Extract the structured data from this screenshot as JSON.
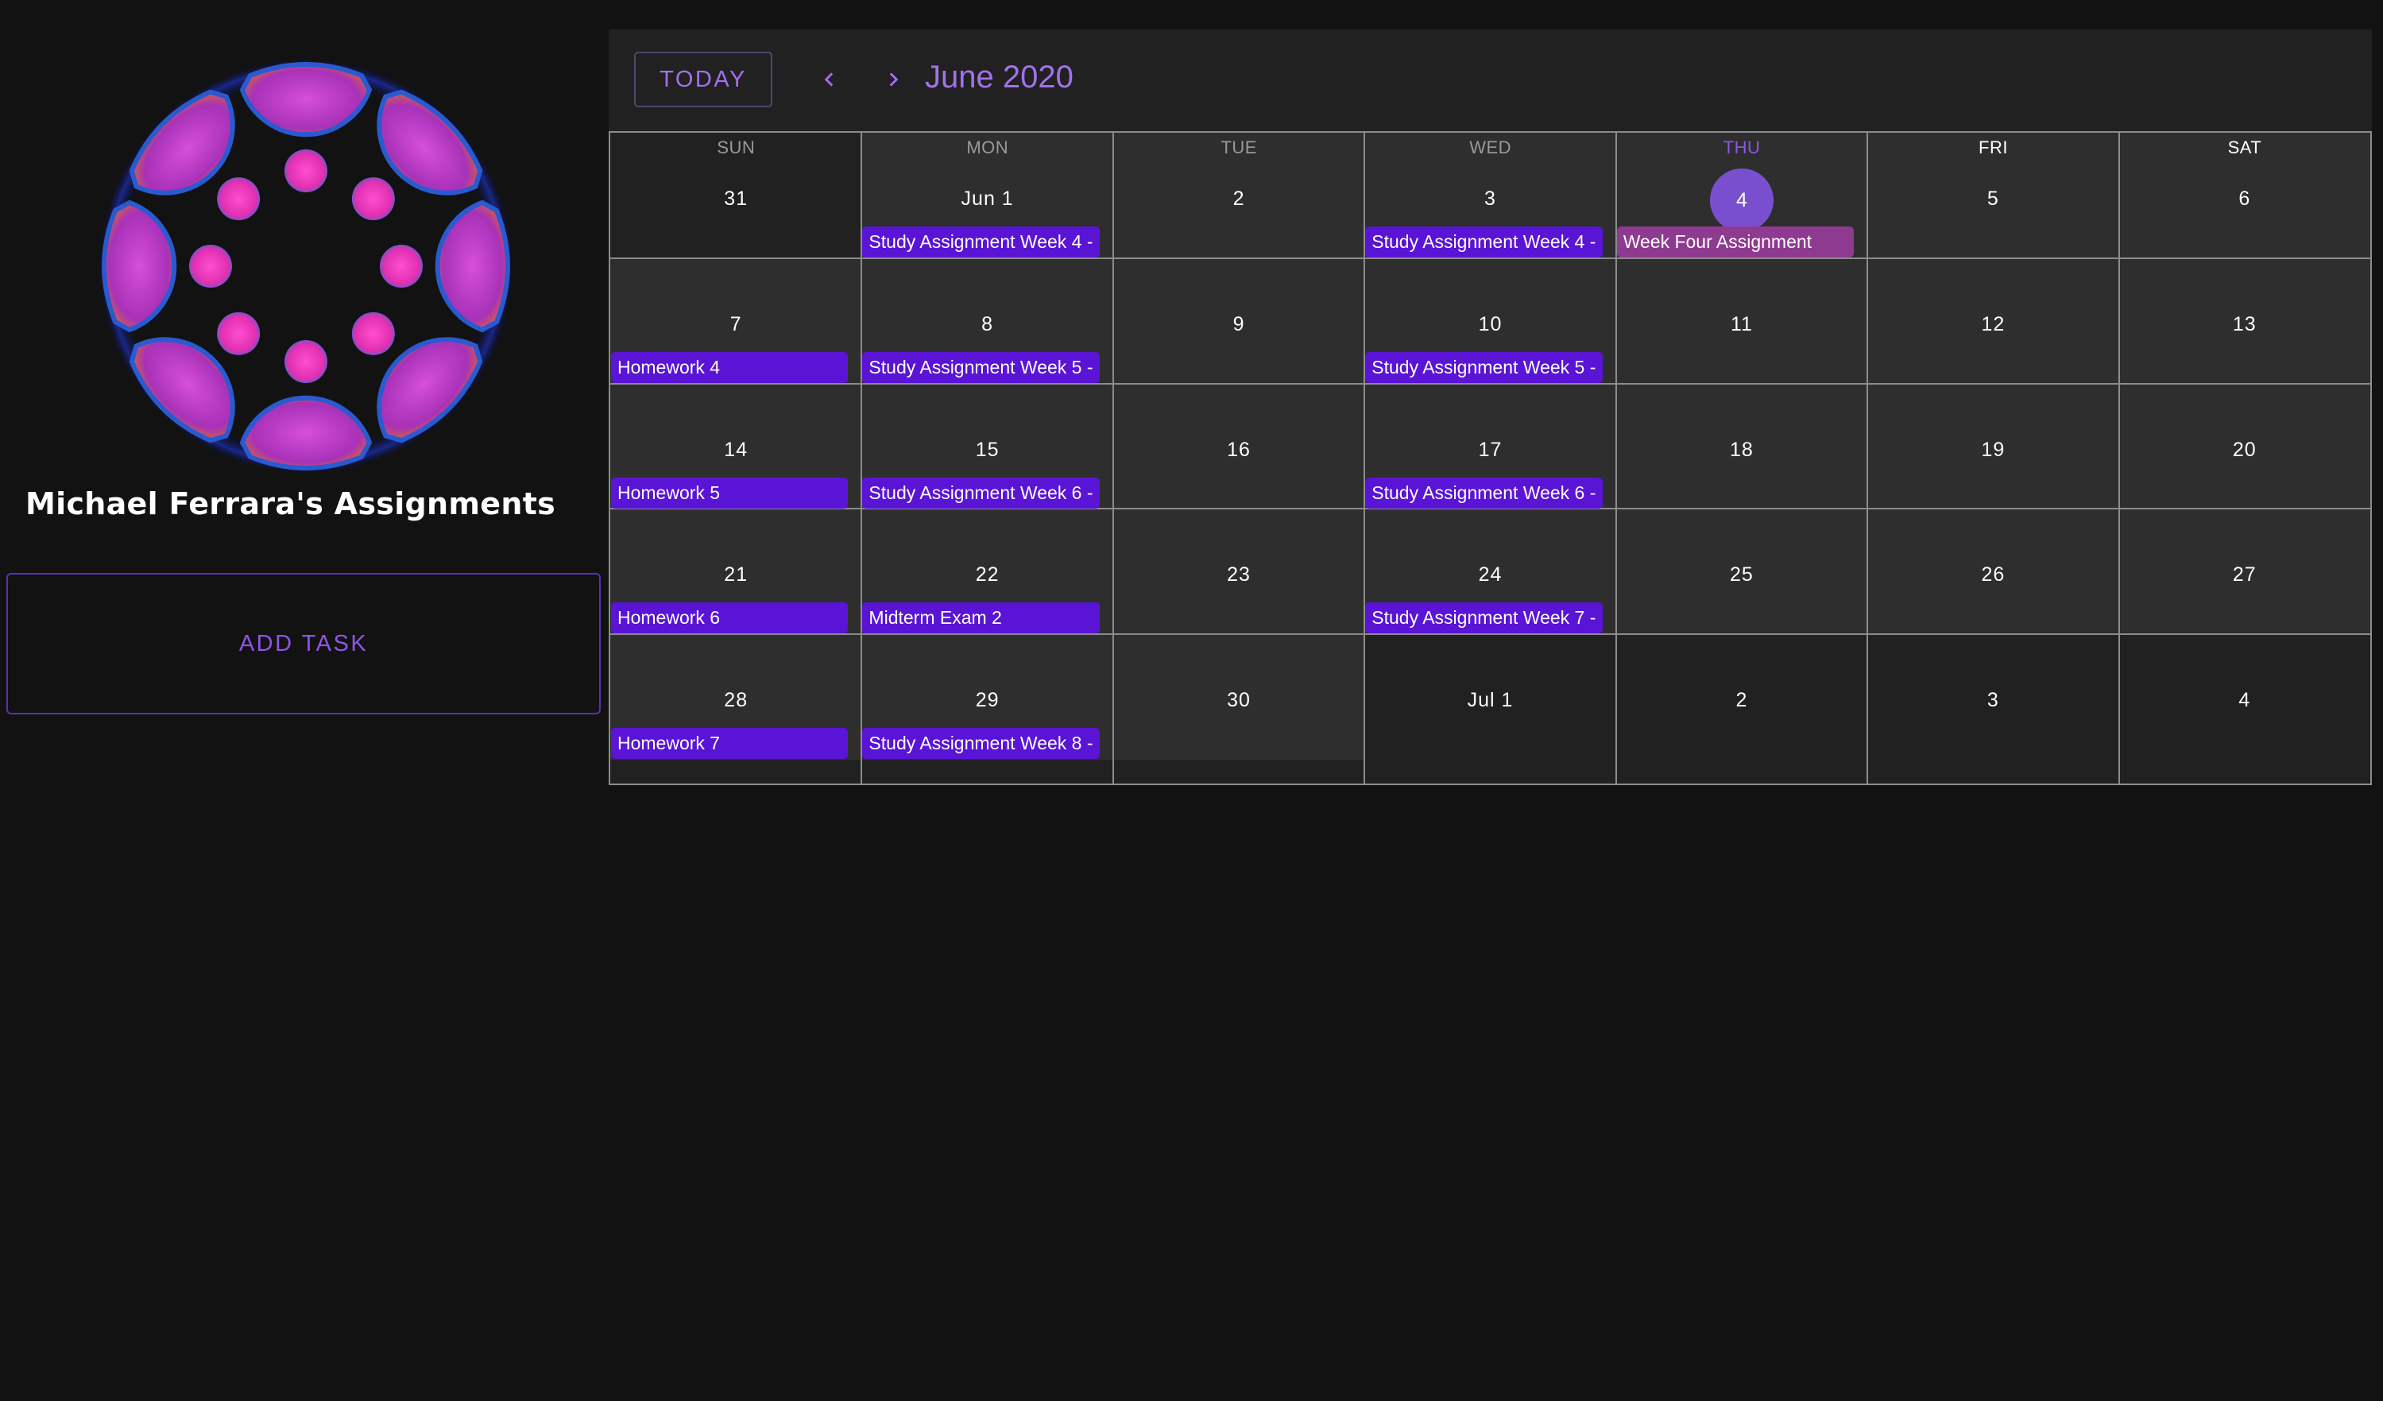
{
  "sidebar": {
    "logo_icon": "flower-logo-icon",
    "title": "Michael Ferrara's Assignments",
    "add_task_label": "ADD TASK"
  },
  "calendar": {
    "today_label": "TODAY",
    "prev_icon": "chevron-left-icon",
    "next_icon": "chevron-right-icon",
    "month_title": "June 2020",
    "weekdays": [
      "SUN",
      "MON",
      "TUE",
      "WED",
      "THU",
      "FRI",
      "SAT"
    ],
    "today_weekday_index": 4,
    "today_date_label": "4",
    "weeks": [
      {
        "days": [
          "31",
          "Jun 1",
          "2",
          "3",
          "4",
          "5",
          "6"
        ],
        "events": [
          {
            "day_index": 1,
            "label": "Study Assignment Week 4 -",
            "color": "purple"
          },
          {
            "day_index": 3,
            "label": "Study Assignment Week 4 -",
            "color": "purple"
          },
          {
            "day_index": 4,
            "label": "Week Four Assignment",
            "color": "magenta"
          }
        ]
      },
      {
        "days": [
          "7",
          "8",
          "9",
          "10",
          "11",
          "12",
          "13"
        ],
        "events": [
          {
            "day_index": 0,
            "label": "Homework 4",
            "color": "purple"
          },
          {
            "day_index": 1,
            "label": "Study Assignment Week 5 -",
            "color": "purple"
          },
          {
            "day_index": 3,
            "label": "Study Assignment Week 5 -",
            "color": "purple"
          }
        ]
      },
      {
        "days": [
          "14",
          "15",
          "16",
          "17",
          "18",
          "19",
          "20"
        ],
        "events": [
          {
            "day_index": 0,
            "label": "Homework 5",
            "color": "purple"
          },
          {
            "day_index": 1,
            "label": "Study Assignment Week 6 -",
            "color": "purple"
          },
          {
            "day_index": 3,
            "label": "Study Assignment Week 6 -",
            "color": "purple"
          }
        ]
      },
      {
        "days": [
          "21",
          "22",
          "23",
          "24",
          "25",
          "26",
          "27"
        ],
        "events": [
          {
            "day_index": 0,
            "label": "Homework 6",
            "color": "purple"
          },
          {
            "day_index": 1,
            "label": "Midterm Exam 2",
            "color": "purple"
          },
          {
            "day_index": 3,
            "label": "Study Assignment Week 7 -",
            "color": "purple"
          }
        ]
      },
      {
        "days": [
          "28",
          "29",
          "30",
          "Jul 1",
          "2",
          "3",
          "4"
        ],
        "events": [
          {
            "day_index": 0,
            "label": "Homework 7",
            "color": "purple"
          },
          {
            "day_index": 1,
            "label": "Study Assignment Week 8 -",
            "color": "purple"
          }
        ]
      }
    ]
  },
  "colors": {
    "background": "#121212",
    "accent": "#8e55e6",
    "event_purple": "#5a14d6",
    "event_magenta": "#8e3a90",
    "today_circle": "#7a4fcf"
  }
}
